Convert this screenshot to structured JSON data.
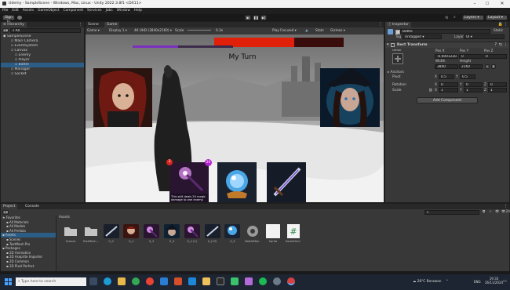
{
  "window": {
    "title": "Udemy - SampleScene - Windows, Mac, Linux - Unity 2022.3.8f1 <DX11>",
    "menu": [
      "File",
      "Edit",
      "Assets",
      "GameObject",
      "Component",
      "Services",
      "Jobs",
      "Window",
      "Help"
    ],
    "account_label": "Sign In",
    "layers_label": "Layers",
    "layout_label": "Layout"
  },
  "hierarchy": {
    "tab": "Hierarchy",
    "search_placeholder": "All",
    "items": [
      {
        "label": "SampleScene",
        "depth": 0,
        "selected": false
      },
      {
        "label": "Main Camera",
        "depth": 2,
        "selected": false
      },
      {
        "label": "EventSystem",
        "depth": 2,
        "selected": false
      },
      {
        "label": "Canvas",
        "depth": 2,
        "selected": false
      },
      {
        "label": "Enemy",
        "depth": 3,
        "selected": false
      },
      {
        "label": "Player",
        "depth": 3,
        "selected": false
      },
      {
        "label": "Battle",
        "depth": 3,
        "selected": true
      },
      {
        "label": "Manager",
        "depth": 2,
        "selected": false
      },
      {
        "label": "Socket",
        "depth": 2,
        "selected": false
      }
    ]
  },
  "scene_view": {
    "tabs": [
      "Scene",
      "Game"
    ],
    "display_mode": "Game",
    "display": "Display 1",
    "resolution": "4K UHD (3840x2160)",
    "scale_label": "Scale",
    "scale_value": "0.3x",
    "play_focused": "Play Focused",
    "stats_label": "Stats",
    "gizmos_label": "Gizmos"
  },
  "game": {
    "turn_text": "My Turn",
    "card_count": "3",
    "card_cost": "20",
    "card_description": "This skill deals 20 magic damage to one enemy.",
    "enemy_hp_fraction": 0.62,
    "player_mana_fraction": 0.45
  },
  "inspector": {
    "tab": "Inspector",
    "object_name": "Battle",
    "static_label": "Static",
    "tag_label": "Tag",
    "tag_value": "Untagged",
    "layer_label": "Layer",
    "layer_value": "UI",
    "component_title": "Rect Transform",
    "anchor_label": "center",
    "pos_x_label": "Pos X",
    "pos_y_label": "Pos Y",
    "pos_z_label": "Pos Z",
    "pos_x": "-0.00012207",
    "pos_y": "0",
    "pos_z": "0",
    "width_label": "Width",
    "height_label": "Height",
    "width": "3840",
    "height": "2160",
    "anchors_label": "Anchors",
    "pivot_label": "Pivot",
    "pivot_x": "0.5",
    "pivot_y": "0.5",
    "rotation_label": "Rotation",
    "rot_x": "0",
    "rot_y": "0",
    "rot_z": "0",
    "scale_label": "Scale",
    "scale_x": "1",
    "scale_y": "1",
    "scale_z": "1",
    "add_component": "Add Component"
  },
  "project": {
    "tabs": [
      "Project",
      "Console"
    ],
    "breadcrumb": "Assets",
    "item_count": "24",
    "tree": [
      {
        "label": "Favorites",
        "depth": 0,
        "selected": false
      },
      {
        "label": "All Materials",
        "depth": 1,
        "selected": false
      },
      {
        "label": "All Models",
        "depth": 1,
        "selected": false
      },
      {
        "label": "All Prefabs",
        "depth": 1,
        "selected": false
      },
      {
        "label": "Assets",
        "depth": 0,
        "selected": true
      },
      {
        "label": "Scenes",
        "depth": 1,
        "selected": false
      },
      {
        "label": "TextMesh Pro",
        "depth": 1,
        "selected": false
      },
      {
        "label": "Packages",
        "depth": 0,
        "selected": false
      },
      {
        "label": "2D Animation",
        "depth": 1,
        "selected": false
      },
      {
        "label": "2D Aseprite Importer",
        "depth": 1,
        "selected": false
      },
      {
        "label": "2D Common",
        "depth": 1,
        "selected": false
      },
      {
        "label": "2D Pixel Perfect",
        "depth": 1,
        "selected": false
      }
    ],
    "assets": [
      {
        "name": "Scenes",
        "kind": "folder"
      },
      {
        "name": "TextMesh...",
        "kind": "folder"
      },
      {
        "name": "0_0",
        "kind": "sword"
      },
      {
        "name": "0_1",
        "kind": "warrior"
      },
      {
        "name": "0_2",
        "kind": "wand"
      },
      {
        "name": "0_3",
        "kind": "wizard"
      },
      {
        "name": "0_2 (1)",
        "kind": "wand"
      },
      {
        "name": "0_(13)",
        "kind": "sword"
      },
      {
        "name": "0_3",
        "kind": "orb"
      },
      {
        "name": "BattleMan...",
        "kind": "gear"
      },
      {
        "name": "Sprite",
        "kind": "white"
      },
      {
        "name": "SocketScri...",
        "kind": "script"
      }
    ]
  },
  "taskbar": {
    "search_placeholder": "Type here to search",
    "weather_temp": "28°C",
    "weather_text": "Berawan",
    "language": "ENG",
    "time": "19:33",
    "date": "26/11/2024"
  },
  "colors": {
    "editor_bg": "#383838",
    "selection": "#2c5d87",
    "hp_bar": "#e1200a",
    "mana_bar": "#7b2fbf",
    "cost_badge": "#b41fd0",
    "count_badge": "#d9261e"
  }
}
